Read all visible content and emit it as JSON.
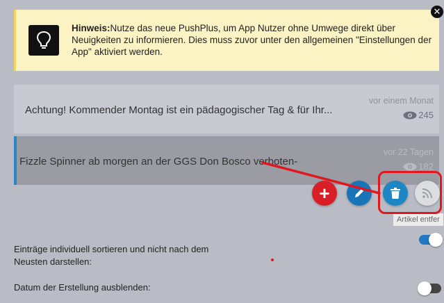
{
  "notice": {
    "bold": "Hinweis:",
    "text": "Nutze das neue PushPlus, um App Nutzer ohne Umwege direkt über Neuigkeiten zu informieren. Dies muss zuvor unter den allgemeinen \"Einstellungen der App\" aktiviert werden.",
    "close_label": "✕"
  },
  "news": [
    {
      "title": "Achtung! Kommender Montag ist ein pädagogischer Tag & für Ihr...",
      "time": "vor einem Monat",
      "views": "245"
    },
    {
      "title": "Fizzle Spinner ab morgen an der GGS Don Bosco verboten-",
      "time": "vor 22 Tagen",
      "views": "182"
    }
  ],
  "actions": {
    "add_label": "+",
    "tooltip": "Artikel entfer"
  },
  "settings": {
    "sort_label": "Einträge individuell sortieren und nicht nach dem Neusten darstellen:",
    "sort_enabled": true,
    "hide_date_label": "Datum der Erstellung ausblenden:",
    "hide_date_enabled": false
  },
  "colors": {
    "accent": "#1e86c5",
    "add": "#d81f26",
    "notice_bg": "#fbf3c3",
    "annotation": "#e0171f"
  }
}
